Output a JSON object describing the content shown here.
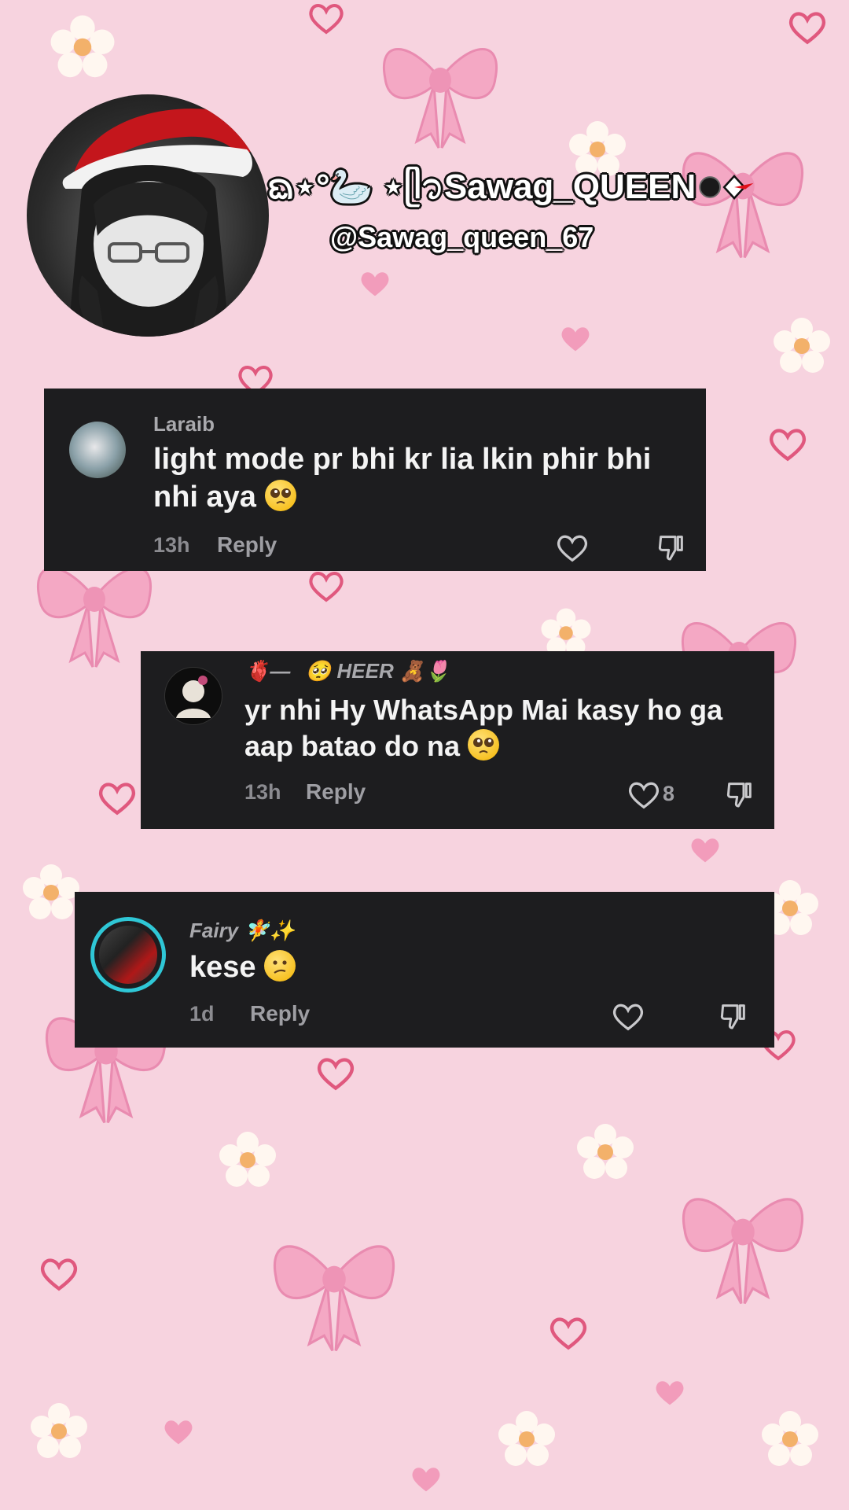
{
  "profile": {
    "display_name": "ᨳ⋆°🦢 ⋆ᥫ᭡Sawag_QUEEN",
    "handle": "@Sawag_queen_67"
  },
  "comments": [
    {
      "username": "Laraib",
      "text": "light mode pr bhi kr lia lkin phir bhi nhi aya",
      "emoji": "pleading-face",
      "time": "13h",
      "reply_label": "Reply",
      "like_count": ""
    },
    {
      "username": "HEER",
      "username_decor": "🫀—⃝🥺",
      "username_suffix": "🧸🌷",
      "text": "yr nhi Hy WhatsApp Mai kasy ho ga aap batao do na",
      "emoji": "pleading-face",
      "time": "13h",
      "reply_label": "Reply",
      "like_count": "8"
    },
    {
      "username": "Fairy",
      "username_suffix": "🧚✨",
      "text": "kese",
      "emoji": "confused-face",
      "time": "1d",
      "reply_label": "Reply",
      "like_count": ""
    }
  ],
  "colors": {
    "background": "#f7d3df",
    "card": "#1d1d1f",
    "bow": "#f3a3c0",
    "heart_outline": "#e0587e"
  }
}
